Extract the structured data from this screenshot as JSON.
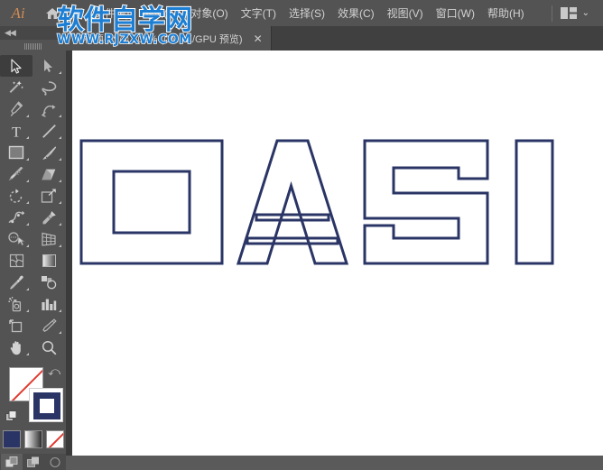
{
  "app": {
    "name": "Adobe Illustrator",
    "logo_text": "Ai",
    "home_icon": "home-icon"
  },
  "menubar": {
    "items": [
      {
        "label": "文件(F)"
      },
      {
        "label": "编辑(E)"
      },
      {
        "label": "对象(O)"
      },
      {
        "label": "文字(T)"
      },
      {
        "label": "选择(S)"
      },
      {
        "label": "效果(C)"
      },
      {
        "label": "视图(V)"
      },
      {
        "label": "窗口(W)"
      },
      {
        "label": "帮助(H)"
      }
    ],
    "arrange_documents_icon": "arrange-documents-icon",
    "chevron": "⌄"
  },
  "tabbar": {
    "tab_label": "无标题-1* @ 100% (CMYK/GPU 预览)",
    "close_label": "✕"
  },
  "toolbar": {
    "collapse_icon": "◀◀",
    "tools": [
      {
        "name": "selection-tool",
        "selected": true,
        "corner": false
      },
      {
        "name": "direct-selection-tool",
        "selected": false,
        "corner": true
      },
      {
        "name": "magic-wand-tool",
        "selected": false,
        "corner": false
      },
      {
        "name": "lasso-tool",
        "selected": false,
        "corner": false
      },
      {
        "name": "pen-tool",
        "selected": false,
        "corner": true
      },
      {
        "name": "curvature-tool",
        "selected": false,
        "corner": true
      },
      {
        "name": "type-tool",
        "selected": false,
        "corner": true
      },
      {
        "name": "line-segment-tool",
        "selected": false,
        "corner": true
      },
      {
        "name": "rectangle-tool",
        "selected": false,
        "corner": true
      },
      {
        "name": "paintbrush-tool",
        "selected": false,
        "corner": true
      },
      {
        "name": "shaper-pencil-tool",
        "selected": false,
        "corner": true
      },
      {
        "name": "eraser-tool",
        "selected": false,
        "corner": true
      },
      {
        "name": "rotate-tool",
        "selected": false,
        "corner": true
      },
      {
        "name": "scale-tool",
        "selected": false,
        "corner": true
      },
      {
        "name": "width-warp-tool",
        "selected": false,
        "corner": true
      },
      {
        "name": "free-transform-tool",
        "selected": false,
        "corner": true
      },
      {
        "name": "shape-builder-tool",
        "selected": false,
        "corner": true
      },
      {
        "name": "perspective-grid-tool",
        "selected": false,
        "corner": true
      },
      {
        "name": "mesh-tool",
        "selected": false,
        "corner": false
      },
      {
        "name": "gradient-tool",
        "selected": false,
        "corner": false
      },
      {
        "name": "eyedropper-tool",
        "selected": false,
        "corner": true
      },
      {
        "name": "blend-tool",
        "selected": false,
        "corner": false
      },
      {
        "name": "symbol-sprayer-tool",
        "selected": false,
        "corner": true
      },
      {
        "name": "column-graph-tool",
        "selected": false,
        "corner": true
      },
      {
        "name": "artboard-tool",
        "selected": false,
        "corner": false
      },
      {
        "name": "slice-tool",
        "selected": false,
        "corner": true
      },
      {
        "name": "hand-tool",
        "selected": false,
        "corner": true
      },
      {
        "name": "zoom-tool",
        "selected": false,
        "corner": false
      }
    ],
    "fill_stroke": {
      "fill_value": "none",
      "fill_color": "#ffffff",
      "stroke_color": "#2a3566",
      "swap_icon": "swap-fill-stroke-icon",
      "default_icon": "default-fill-stroke-icon"
    },
    "color_modes": [
      {
        "name": "color-swatch-button",
        "color": "#2a3566"
      },
      {
        "name": "gradient-swatch-button",
        "color": "gradient"
      },
      {
        "name": "none-swatch-button",
        "color": "none"
      }
    ],
    "draw_modes": [
      {
        "name": "draw-normal-button",
        "active": true
      },
      {
        "name": "draw-behind-button",
        "active": false
      },
      {
        "name": "draw-inside-button",
        "active": false
      }
    ]
  },
  "canvas": {
    "background": "#3b3b3b",
    "artboard_color": "#ffffff",
    "artwork": {
      "text": "OASI",
      "stroke_color": "#2a3566",
      "fill": "none",
      "stroke_width": 3,
      "description": "Outlined letterforms OASI created from expanded text paths"
    }
  },
  "watermark": {
    "chinese": "软件自学网",
    "url": "WWW.RJZXW.COM",
    "color": "#1d7fd4"
  }
}
